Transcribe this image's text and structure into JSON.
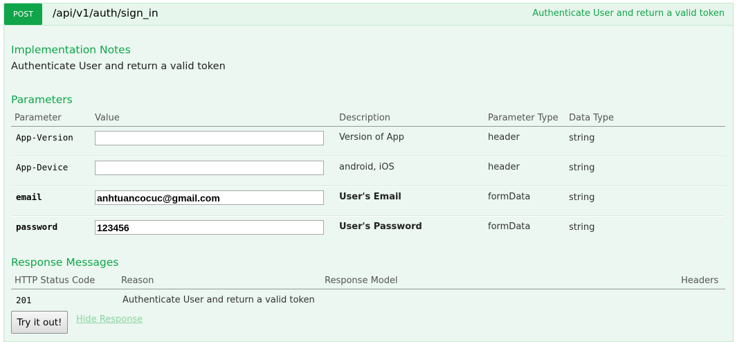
{
  "operation": {
    "method": "POST",
    "path": "/api/v1/auth/sign_in",
    "summary": "Authenticate User and return a valid token"
  },
  "implementation_notes": {
    "heading": "Implementation Notes",
    "text": "Authenticate User and return a valid token"
  },
  "parameters": {
    "heading": "Parameters",
    "columns": [
      "Parameter",
      "Value",
      "Description",
      "Parameter Type",
      "Data Type"
    ],
    "rows": [
      {
        "name": "App-Version",
        "value": "",
        "description": "Version of App",
        "param_type": "header",
        "data_type": "string",
        "required": false
      },
      {
        "name": "App-Device",
        "value": "",
        "description": "android, iOS",
        "param_type": "header",
        "data_type": "string",
        "required": false
      },
      {
        "name": "email",
        "value": "anhtuancocuc@gmail.com",
        "description": "User's Email",
        "param_type": "formData",
        "data_type": "string",
        "required": true
      },
      {
        "name": "password",
        "value": "123456",
        "description": "User's Password",
        "param_type": "formData",
        "data_type": "string",
        "required": true
      }
    ]
  },
  "responses": {
    "heading": "Response Messages",
    "columns": [
      "HTTP Status Code",
      "Reason",
      "Response Model",
      "Headers"
    ],
    "rows": [
      {
        "code": "201",
        "reason": "Authenticate User and return a valid token"
      }
    ]
  },
  "actions": {
    "try_label": "Try it out!",
    "hide_label": "Hide Response"
  },
  "colors": {
    "accent": "#10a54a",
    "panel_bg": "#ebf7f0",
    "border": "#c3e8d1",
    "link_faded": "#8bd3a5"
  }
}
